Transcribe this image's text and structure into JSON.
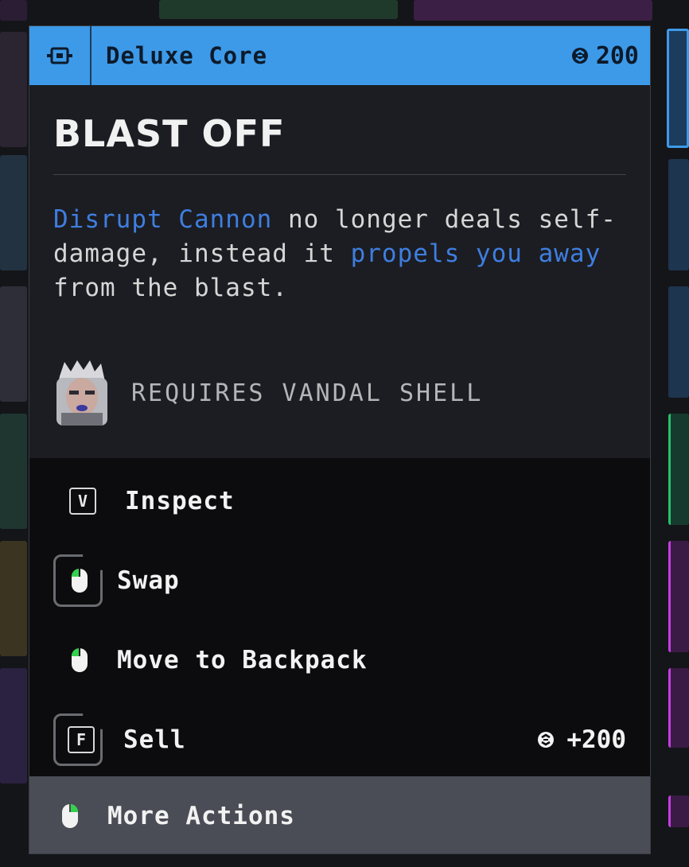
{
  "item": {
    "category": "Deluxe Core",
    "price": "200",
    "name": "BLAST OFF",
    "description": [
      {
        "text": "Disrupt Cannon",
        "highlight": true
      },
      {
        "text": " no longer deals self-damage, instead  it ",
        "highlight": false
      },
      {
        "text": "propels you away",
        "highlight": true
      },
      {
        "text": " from the blast.",
        "highlight": false
      }
    ],
    "requirement": "REQUIRES VANDAL SHELL"
  },
  "actions": {
    "inspect": {
      "key": "V",
      "label": "Inspect"
    },
    "swap": {
      "label": "Swap"
    },
    "move": {
      "label": "Move to Backpack"
    },
    "sell": {
      "key": "F",
      "label": "Sell",
      "value": "+200"
    },
    "more": {
      "label": "More Actions"
    }
  },
  "colors": {
    "header": "#3d9ae8",
    "highlight": "#3f7ee0",
    "mouse_accent": "#33d14c"
  },
  "icons": {
    "category": "core-chip-icon",
    "currency": "credits-icon",
    "mouse": "mouse-icon"
  }
}
